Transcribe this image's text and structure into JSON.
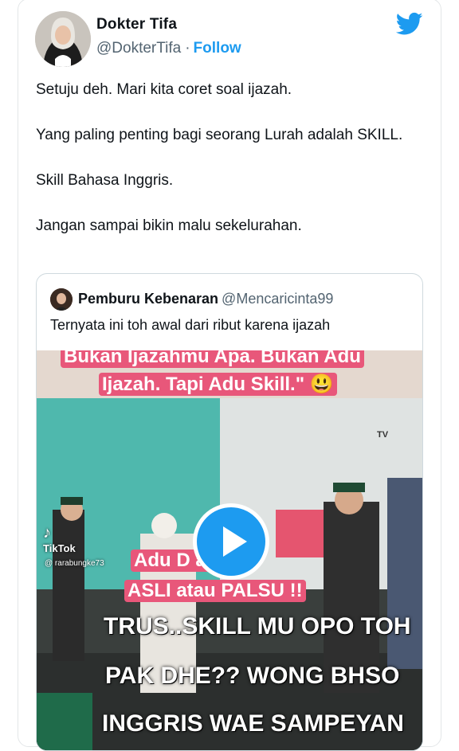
{
  "author": {
    "name": "Dokter Tifa",
    "handle": "@DokterTifa",
    "separator": "·",
    "follow_label": "Follow"
  },
  "brand_icon": "twitter-bird-icon",
  "tweet": {
    "paragraphs": [
      "Setuju deh. Mari kita coret soal ijazah.",
      "Yang paling penting bagi seorang Lurah adalah SKILL.",
      "Skill Bahasa Inggris.",
      "Jangan sampai bikin malu sekelurahan."
    ]
  },
  "quoted": {
    "name": "Pemburu Kebenaran",
    "handle": "@Mencaricinta99",
    "text": "Ternyata ini toh awal dari ribut karena ijazah"
  },
  "video": {
    "play_icon": "play-icon",
    "captions": {
      "top_line1": "Bukan Ijazahmu Apa. Bukan Adu",
      "top_line2": "Ijazah. Tapi Adu Skill.\" 😃",
      "mid_line1": "Adu D     adilan",
      "mid_line2": "ASLI atau PALSU !!",
      "bottom_line1": "TRUS..SKILL MU OPO TOH",
      "bottom_line2": "PAK DHE?? WONG BHSO",
      "bottom_line3": "INGGRIS WAE SAMPEYAN"
    },
    "watermark": "TikTok",
    "watermark_user": "@ rarabungke73",
    "tv_label": "TV"
  },
  "colors": {
    "accent": "#1d9bf0",
    "text": "#0f1419",
    "muted": "#536471",
    "caption_pink": "#e8577a"
  }
}
